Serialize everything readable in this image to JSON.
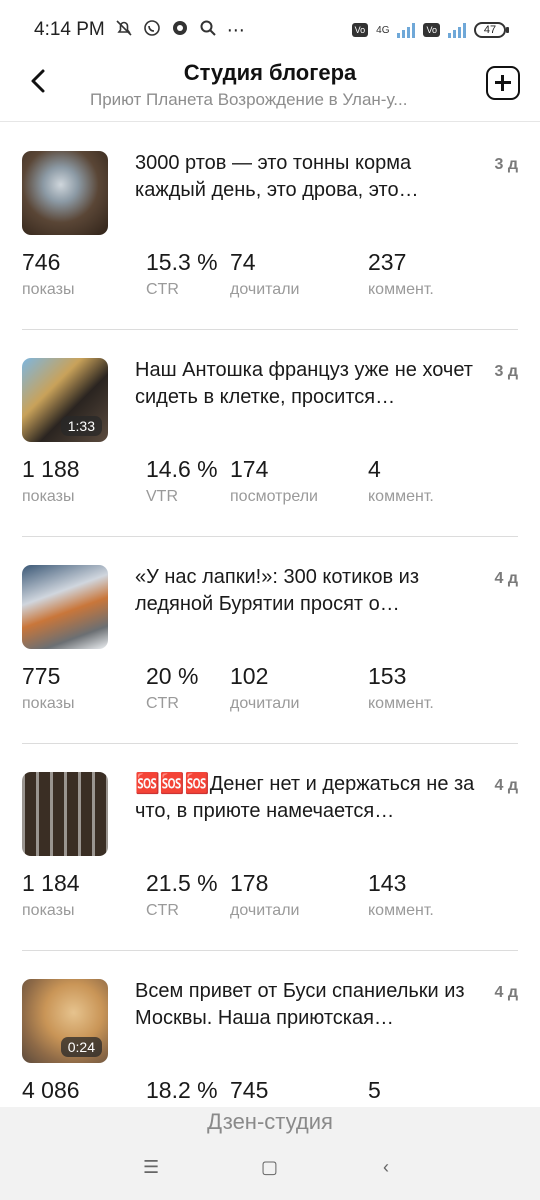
{
  "status_bar": {
    "time": "4:14 PM",
    "icons": [
      "bell-off-icon",
      "whatsapp-icon",
      "messenger-icon",
      "search-icon",
      "more-icon"
    ],
    "network": "4G",
    "battery": "47"
  },
  "header": {
    "title": "Студия блогера",
    "subtitle": "Приют Планета Возрождение в Улан-у..."
  },
  "posts": [
    {
      "text": "3000 ртов — это тонны корма каждый день, это дрова, это…",
      "age": "3 д",
      "duration": "",
      "stats": [
        {
          "value": "746",
          "label": "показы"
        },
        {
          "value": "15.3 %",
          "label": "CTR"
        },
        {
          "value": "74",
          "label": "дочитали"
        },
        {
          "value": "237",
          "label": "коммент."
        }
      ]
    },
    {
      "text": "Наш Антошка француз уже не хочет сидеть в клетке, просится…",
      "age": "3 д",
      "duration": "1:33",
      "stats": [
        {
          "value": "1 188",
          "label": "показы"
        },
        {
          "value": "14.6 %",
          "label": "VTR"
        },
        {
          "value": "174",
          "label": "посмотрели"
        },
        {
          "value": "4",
          "label": "коммент."
        }
      ]
    },
    {
      "text": "«У нас лапки!»: 300 котиков из ледяной Бурятии просят о…",
      "age": "4 д",
      "duration": "",
      "stats": [
        {
          "value": "775",
          "label": "показы"
        },
        {
          "value": "20 %",
          "label": "CTR"
        },
        {
          "value": "102",
          "label": "дочитали"
        },
        {
          "value": "153",
          "label": "коммент."
        }
      ]
    },
    {
      "text": "🆘🆘🆘Денег нет и держаться не за что, в приюте намечается…",
      "age": "4 д",
      "duration": "",
      "stats": [
        {
          "value": "1 184",
          "label": "показы"
        },
        {
          "value": "21.5 %",
          "label": "CTR"
        },
        {
          "value": "178",
          "label": "дочитали"
        },
        {
          "value": "143",
          "label": "коммент."
        }
      ]
    },
    {
      "text": "Всем привет от Буси спаниельки из Москвы. Наша приютская…",
      "age": "4 д",
      "duration": "0:24",
      "stats": [
        {
          "value": "4 086",
          "label": ""
        },
        {
          "value": "18.2 %",
          "label": ""
        },
        {
          "value": "745",
          "label": ""
        },
        {
          "value": "5",
          "label": ""
        }
      ]
    }
  ],
  "bottom": {
    "label": "Дзен-студия"
  },
  "nav": {
    "menu": "☰",
    "home": "▢",
    "back": "‹"
  }
}
